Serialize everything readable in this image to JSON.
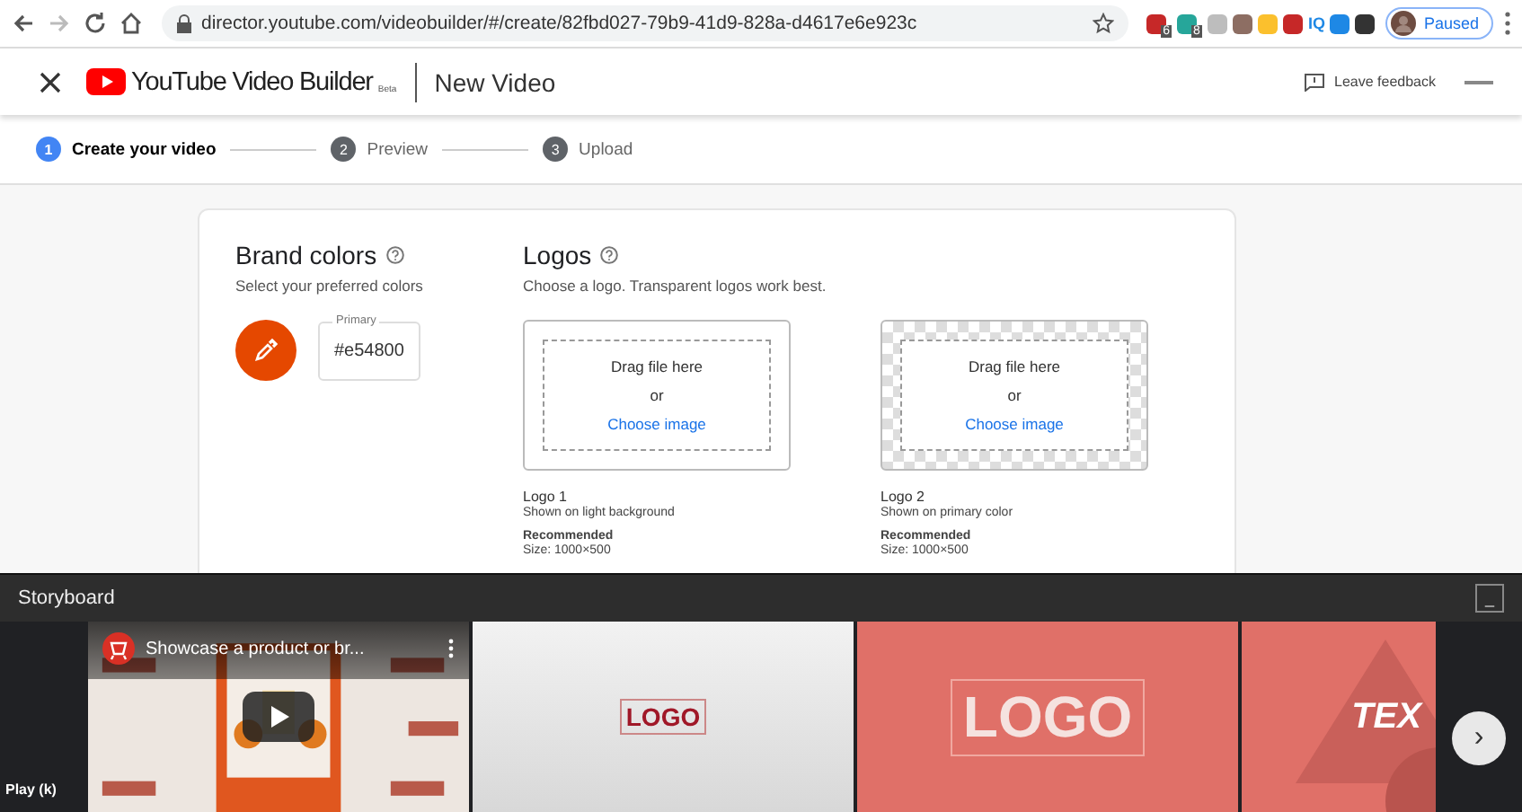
{
  "browser": {
    "url": "director.youtube.com/videobuilder/#/create/82fbd027-79b9-41d9-828a-d4617e6e923c",
    "extensions": [
      {
        "color": "#c62828",
        "badge": "6"
      },
      {
        "color": "#26a69a",
        "badge": "8"
      },
      {
        "color": "#bdbdbd"
      },
      {
        "color": "#8d6e63"
      },
      {
        "color": "#fbc02d"
      },
      {
        "color": "#c62828"
      },
      {
        "color": "#1e88e5"
      },
      {
        "color": "#333333"
      }
    ],
    "ext_text": "IQ",
    "profile": "Paused"
  },
  "header": {
    "brand": "YouTube Video Builder",
    "beta": "Beta",
    "title": "New Video",
    "feedback": "Leave feedback"
  },
  "steps": [
    {
      "number": "1",
      "label": "Create your video",
      "selected": true
    },
    {
      "number": "2",
      "label": "Preview",
      "selected": false
    },
    {
      "number": "3",
      "label": "Upload",
      "selected": false
    }
  ],
  "brand_colors": {
    "title": "Brand colors",
    "subtitle": "Select your preferred colors",
    "field_label": "Primary",
    "value": "#e54800",
    "color": "#e54800"
  },
  "logos": {
    "title": "Logos",
    "subtitle": "Choose a logo. Transparent logos work best.",
    "slots": [
      {
        "kind": "plain",
        "drag": "Drag file here",
        "or": "or",
        "link": "Choose image",
        "name": "Logo 1",
        "desc": "Shown on light background",
        "rec": "Recommended",
        "size": "Size: 1000×500"
      },
      {
        "kind": "checker",
        "drag": "Drag file here",
        "or": "or",
        "link": "Choose image",
        "name": "Logo 2",
        "desc": "Shown on primary color",
        "rec": "Recommended",
        "size": "Size: 1000×500"
      }
    ]
  },
  "storyboard": {
    "title": "Storyboard",
    "minimize": "_",
    "play_tooltip": "Play (k)",
    "video_title": "Showcase a product or br...",
    "frames": [
      {
        "kind": "video"
      },
      {
        "kind": "logo_light",
        "text": "LOGO"
      },
      {
        "kind": "logo_color",
        "text": "LOGO"
      },
      {
        "kind": "text",
        "text": "TEX"
      }
    ],
    "next": "›"
  }
}
